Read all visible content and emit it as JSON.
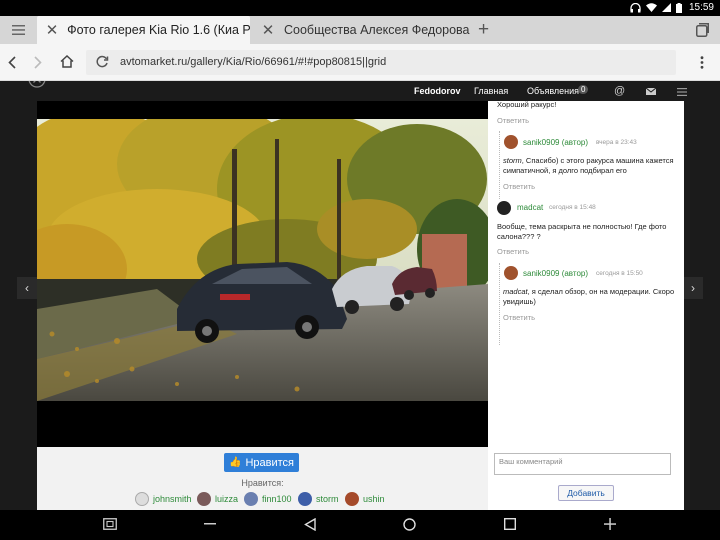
{
  "status": {
    "time": "15:59"
  },
  "tabs": [
    {
      "title": "Фото галерея Kia Rio 1.6 (Киа Рио)",
      "active": true
    },
    {
      "title": "Сообщества Алексея Федорова",
      "active": false
    }
  ],
  "address": {
    "url": "avtomarket.ru/gallery/Kia/Rio/66961/#!#pop80815||grid"
  },
  "site_nav": {
    "user": "Fedodorov",
    "home": "Главная",
    "ads": "Объявления",
    "ads_count": "0"
  },
  "likes": {
    "button_label": "Нравится",
    "label": "Нравится:",
    "users": [
      "johnsmith",
      "luizza",
      "finn100",
      "storm",
      "ushin"
    ]
  },
  "comments": {
    "top_text": "Хороший ракурс!",
    "reply_label": "Ответить",
    "items": [
      {
        "author": "sanik0909 (автор)",
        "time": "вчера в 23:43",
        "mention": "storm",
        "text": ", Спасибо) с этого ракурса машина кажется симпатичной, я долго подбирал его"
      },
      {
        "author": "madcat",
        "time": "сегодня в 15:48",
        "text": "Вообще, тема раскрыта не полностью! Где фото салона??? ?"
      },
      {
        "author": "sanik0909 (автор)",
        "time": "сегодня в 15:50",
        "mention": "madcat",
        "text": ", я сделал обзор, он на модерации. Скоро увидишь)"
      }
    ],
    "input_placeholder": "Ваш комментарий",
    "add_button": "Добавить"
  }
}
